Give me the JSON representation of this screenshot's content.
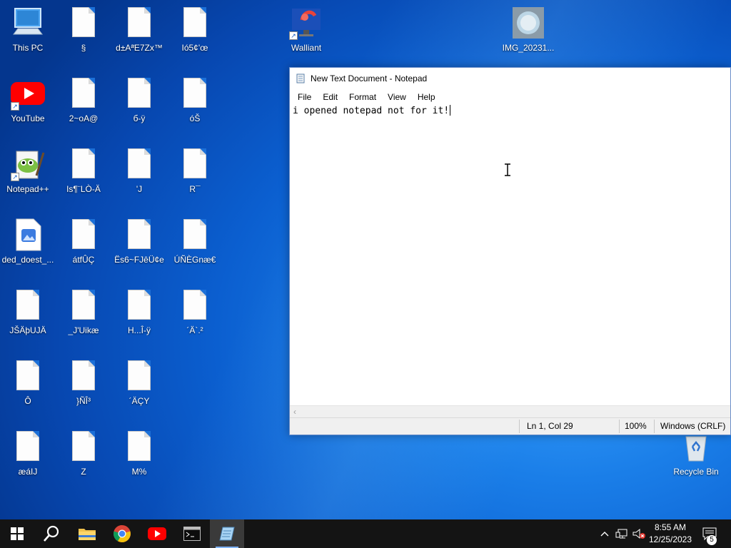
{
  "desktop": {
    "icons": [
      {
        "label": "This PC",
        "kind": "pc"
      },
      {
        "label": "§",
        "kind": "file"
      },
      {
        "label": "d±Aª̈E7Zx™",
        "kind": "file"
      },
      {
        "label": "Ió5¢'œ",
        "kind": "file"
      },
      {
        "label": "Walliant",
        "kind": "walliant"
      },
      {
        "label": "IMG_20231...",
        "kind": "image"
      },
      {
        "label": "YouTube",
        "kind": "youtube"
      },
      {
        "label": "2~oA@",
        "kind": "file"
      },
      {
        "label": "б-ÿ",
        "kind": "file"
      },
      {
        "label": "óŠ",
        "kind": "file"
      },
      {
        "label": "Notepad++",
        "kind": "notepadpp"
      },
      {
        "label": "Is¶¨LÒ-Ä",
        "kind": "file"
      },
      {
        "label": "'J",
        "kind": "file"
      },
      {
        "label": "R¯",
        "kind": "file"
      },
      {
        "label": "ded_doest_...",
        "kind": "imgfile"
      },
      {
        "label": "átfÛÇ",
        "kind": "file"
      },
      {
        "label": "Ës6~FJêÜ¢e",
        "kind": "file"
      },
      {
        "label": "ÚÑÈGnæ€",
        "kind": "file"
      },
      {
        "label": "JŠÄþUJÄ",
        "kind": "file"
      },
      {
        "label": "_J'Uikæ",
        "kind": "file"
      },
      {
        "label": "H...Î-ÿ",
        "kind": "file"
      },
      {
        "label": "´Ä`.²",
        "kind": "file"
      },
      {
        "label": "Ô",
        "kind": "file"
      },
      {
        "label": "}ÑÎ³",
        "kind": "file"
      },
      {
        "label": "´ÄÇY",
        "kind": "file"
      },
      {
        "label": "æáIJ",
        "kind": "file"
      },
      {
        "label": "Z",
        "kind": "file"
      },
      {
        "label": "M%",
        "kind": "file"
      },
      {
        "label": "Recycle Bin",
        "kind": "recycle"
      }
    ]
  },
  "notepad": {
    "title": "New Text Document - Notepad",
    "menu": [
      "File",
      "Edit",
      "Format",
      "View",
      "Help"
    ],
    "content": "i opened notepad not for it!",
    "status": {
      "position": "Ln 1, Col 29",
      "zoom": "100%",
      "line_ending": "Windows (CRLF)"
    }
  },
  "taskbar": {
    "time": "8:55 AM",
    "date": "12/25/2023",
    "notification_count": "5",
    "accent": "#7fb3ff"
  }
}
